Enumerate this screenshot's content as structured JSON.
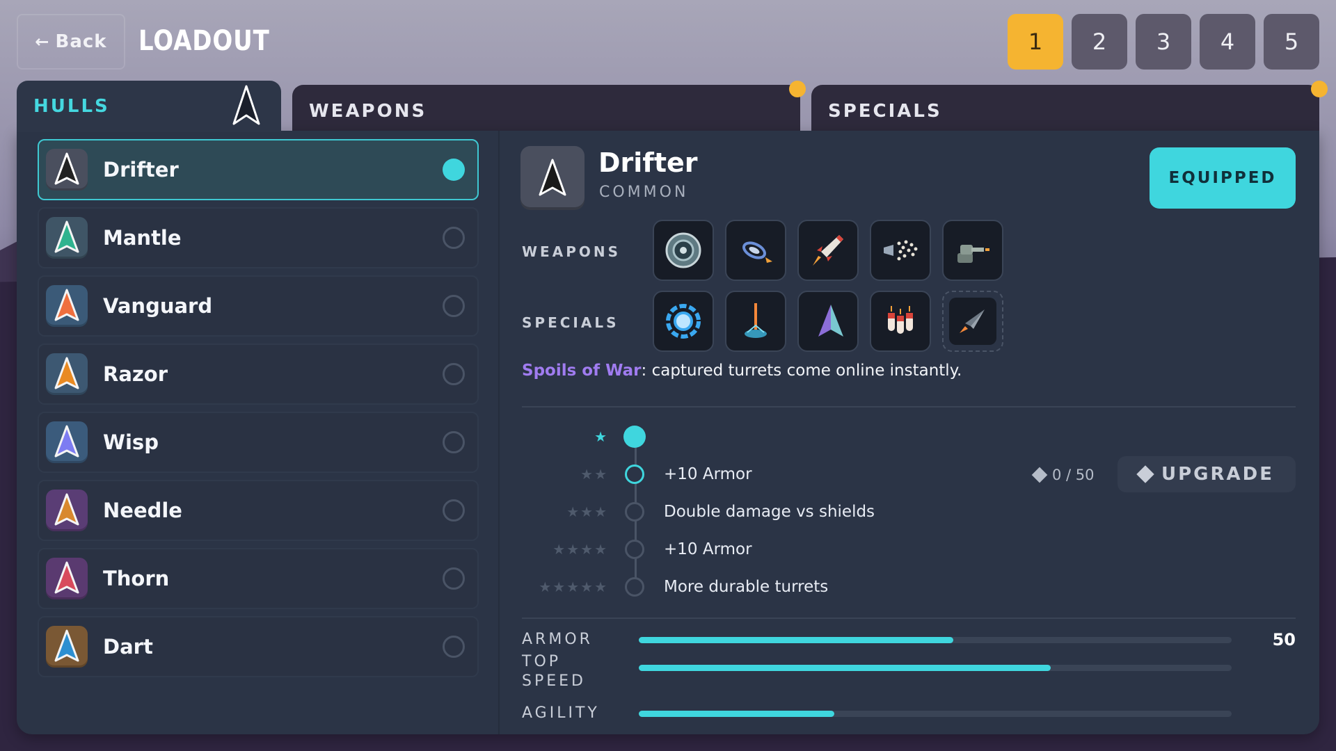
{
  "header": {
    "back_label": "Back",
    "title": "LOADOUT",
    "slots": [
      "1",
      "2",
      "3",
      "4",
      "5"
    ],
    "active_slot": "1"
  },
  "tabs": {
    "hulls": "HULLS",
    "weapons": "WEAPONS",
    "specials": "SPECIALS"
  },
  "hulls": [
    {
      "name": "Drifter",
      "selected": true,
      "color": "#222222",
      "bg": "#4a4f5e"
    },
    {
      "name": "Mantle",
      "selected": false,
      "color": "#2fb38f",
      "bg": "#3f5566"
    },
    {
      "name": "Vanguard",
      "selected": false,
      "color": "#ef6f3e",
      "bg": "#3b5a78"
    },
    {
      "name": "Razor",
      "selected": false,
      "color": "#e98a22",
      "bg": "#3d5872"
    },
    {
      "name": "Wisp",
      "selected": false,
      "color": "#7d7cf2",
      "bg": "#3b5b7c"
    },
    {
      "name": "Needle",
      "selected": false,
      "color": "#d8892e",
      "bg": "#5a3d75"
    },
    {
      "name": "Thorn",
      "selected": false,
      "color": "#d84a5c",
      "bg": "#5a3a70"
    },
    {
      "name": "Dart",
      "selected": false,
      "color": "#2c8fd1",
      "bg": "#7a5834"
    }
  ],
  "detail": {
    "name": "Drifter",
    "rarity": "COMMON",
    "equipped_label": "EQUIPPED",
    "weapons_label": "WEAPONS",
    "specials_label": "SPECIALS",
    "weapon_icons": [
      "disc-blade-icon",
      "vortex-shot-icon",
      "rocket-icon",
      "scatter-shot-icon",
      "turret-cannon-icon"
    ],
    "special_icons": [
      "shield-ring-icon",
      "orbital-strike-icon",
      "decoy-ship-icon",
      "missile-barrage-icon",
      "fighter-drone-icon"
    ],
    "special_desc_highlight": "Spoils of War",
    "special_desc_rest": ": captured turrets come online instantly."
  },
  "upgrades": {
    "tiers": [
      {
        "stars": "★",
        "text": ""
      },
      {
        "stars": "★★",
        "text": "+10 Armor"
      },
      {
        "stars": "★★★",
        "text": "Double damage vs shields"
      },
      {
        "stars": "★★★★",
        "text": "+10 Armor"
      },
      {
        "stars": "★★★★★",
        "text": "More durable turrets"
      }
    ],
    "current_tier": 1,
    "cost": "0 / 50",
    "upgrade_label": "UPGRADE"
  },
  "stats": [
    {
      "label": "ARMOR",
      "fill": 0.53,
      "value": "50"
    },
    {
      "label": "TOP SPEED",
      "fill": 0.695,
      "value": ""
    },
    {
      "label": "AGILITY",
      "fill": 0.33,
      "value": ""
    }
  ],
  "colors": {
    "accent": "#3fd6de",
    "gold": "#f5b431",
    "special_highlight": "#a07cf0"
  }
}
